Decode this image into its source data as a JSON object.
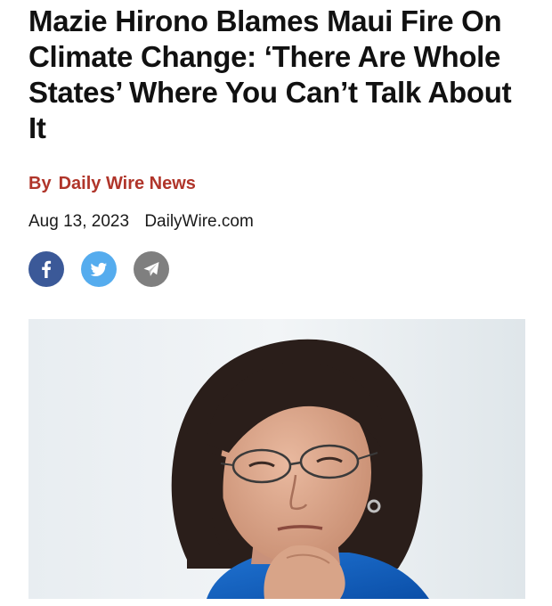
{
  "article": {
    "headline": "Mazie Hirono Blames Maui Fire On Climate Change: ‘There Are Whole States’ Where You Can’t Talk About It",
    "byline_prefix": "By",
    "author": "Daily Wire News",
    "date": "Aug 13, 2023",
    "source": "DailyWire.com"
  },
  "share": [
    {
      "name": "facebook",
      "icon": "facebook-icon",
      "color": "#3b5998"
    },
    {
      "name": "twitter",
      "icon": "twitter-icon",
      "color": "#55acee"
    },
    {
      "name": "send",
      "icon": "paper-plane-icon",
      "color": "#7f7f7f"
    }
  ],
  "colors": {
    "byline": "#b0352a",
    "text": "#111111",
    "background": "#ffffff"
  }
}
